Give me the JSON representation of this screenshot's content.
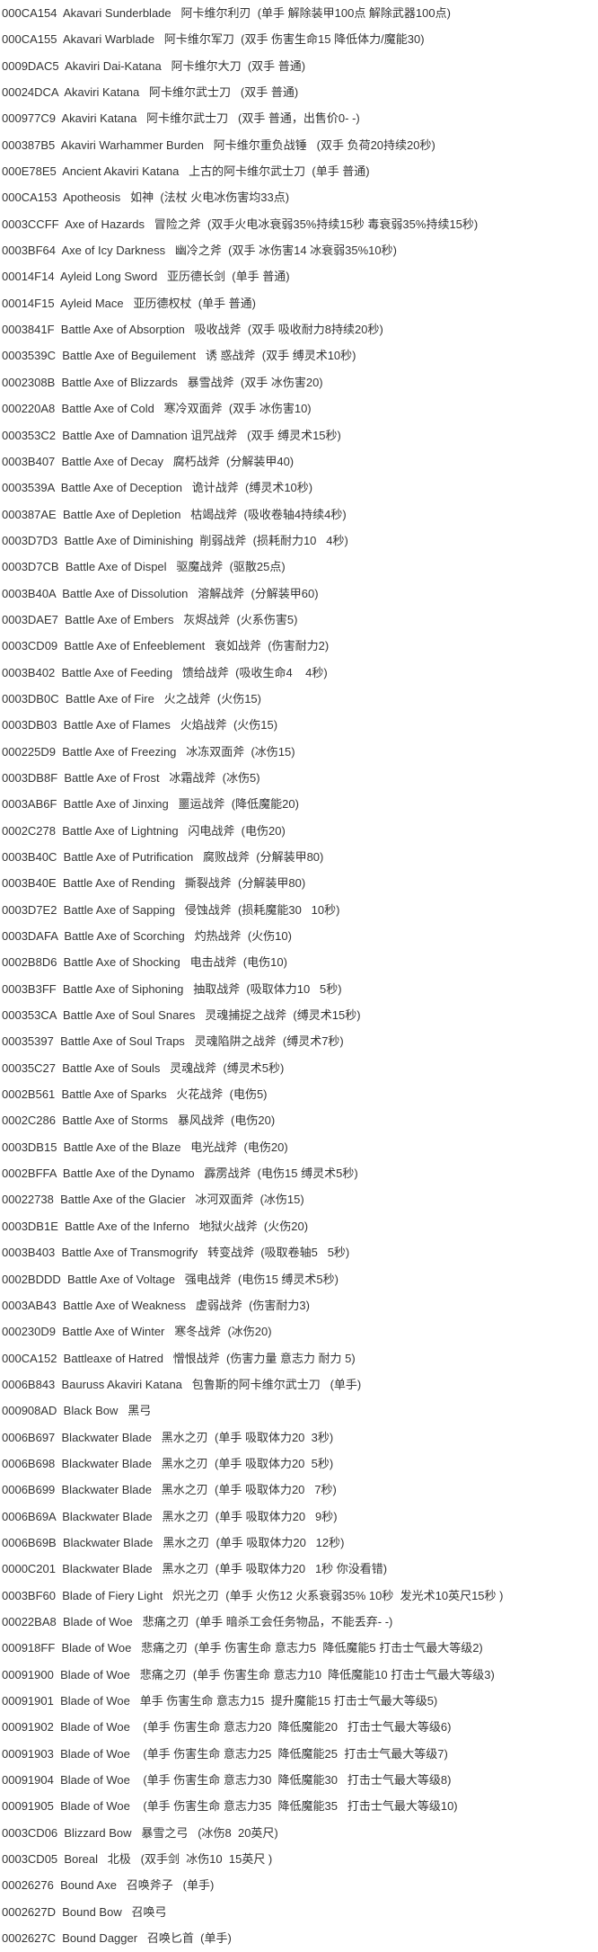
{
  "items": [
    "000CA154  Akavari Sunderblade   阿卡维尔利刃  (单手 解除装甲100点 解除武器100点)",
    "000CA155  Akavari Warblade   阿卡维尔军刀  (双手 伤害生命15 降低体力/魔能30)",
    "0009DAC5  Akaviri Dai-Katana   阿卡维尔大刀  (双手 普通)",
    "00024DCA  Akaviri Katana   阿卡维尔武士刀   (双手 普通)",
    "000977C9  Akaviri Katana   阿卡维尔武士刀   (双手 普通，出售价0- -)",
    "000387B5  Akaviri Warhammer Burden   阿卡维尔重负战锤   (双手 负荷20持续20秒)",
    "000E78E5  Ancient Akaviri Katana   上古的阿卡维尔武士刀  (单手 普通)",
    "000CA153  Apotheosis   如神  (法杖 火电冰伤害均33点)",
    "0003CCFF  Axe of Hazards   冒险之斧  (双手火电冰衰弱35%持续15秒 毒衰弱35%持续15秒)",
    "0003BF64  Axe of Icy Darkness   幽冷之斧  (双手 冰伤害14 冰衰弱35%10秒)",
    "00014F14  Ayleid Long Sword   亚历德长剑  (单手 普通)",
    "00014F15  Ayleid Mace   亚历德权杖  (单手 普通)",
    "0003841F  Battle Axe of Absorption   吸收战斧  (双手 吸收耐力8持续20秒)",
    "0003539C  Battle Axe of Beguilement   诱 惑战斧  (双手 缚灵术10秒)",
    "0002308B  Battle Axe of Blizzards   暴雪战斧  (双手 冰伤害20)",
    "000220A8  Battle Axe of Cold   寒冷双面斧  (双手 冰伤害10)",
    "000353C2  Battle Axe of Damnation 诅咒战斧   (双手 缚灵术15秒)",
    "0003B407  Battle Axe of Decay   腐朽战斧  (分解装甲40)",
    "0003539A  Battle Axe of Deception   诡计战斧  (缚灵术10秒)",
    "000387AE  Battle Axe of Depletion   枯竭战斧  (吸收卷轴4持续4秒)",
    "0003D7D3  Battle Axe of Diminishing  削弱战斧  (损耗耐力10   4秒)",
    "0003D7CB  Battle Axe of Dispel   驱魔战斧  (驱散25点)",
    "0003B40A  Battle Axe of Dissolution   溶解战斧  (分解装甲60)",
    "0003DAE7  Battle Axe of Embers   灰烬战斧  (火系伤害5)",
    "0003CD09  Battle Axe of Enfeeblement   衰如战斧  (伤害耐力2)",
    "0003B402  Battle Axe of Feeding   馈给战斧  (吸收生命4    4秒)",
    "0003DB0C  Battle Axe of Fire   火之战斧  (火伤15)",
    "0003DB03  Battle Axe of Flames   火焰战斧  (火伤15)",
    "000225D9  Battle Axe of Freezing   冰冻双面斧  (冰伤15)",
    "0003DB8F  Battle Axe of Frost   冰霜战斧  (冰伤5)",
    "0003AB6F  Battle Axe of Jinxing   噩运战斧  (降低魔能20)",
    "0002C278  Battle Axe of Lightning   闪电战斧  (电伤20)",
    "0003B40C  Battle Axe of Putrification   腐败战斧  (分解装甲80)",
    "0003B40E  Battle Axe of Rending   撕裂战斧  (分解装甲80)",
    "0003D7E2  Battle Axe of Sapping   侵蚀战斧  (损耗魔能30   10秒)",
    "0003DAFA  Battle Axe of Scorching   灼热战斧  (火伤10)",
    "0002B8D6  Battle Axe of Shocking   电击战斧  (电伤10)",
    "0003B3FF  Battle Axe of Siphoning   抽取战斧  (吸取体力10   5秒)",
    "000353CA  Battle Axe of Soul Snares   灵魂捕捉之战斧  (缚灵术15秒)",
    "00035397  Battle Axe of Soul Traps   灵魂陷阱之战斧  (缚灵术7秒)",
    "00035C27  Battle Axe of Souls   灵魂战斧  (缚灵术5秒)",
    "0002B561  Battle Axe of Sparks   火花战斧  (电伤5)",
    "0002C286  Battle Axe of Storms   暴风战斧  (电伤20)",
    "0003DB15  Battle Axe of the Blaze   电光战斧  (电伤20)",
    "0002BFFA  Battle Axe of the Dynamo   霹雳战斧  (电伤15 缚灵术5秒)",
    "00022738  Battle Axe of the Glacier   冰河双面斧  (冰伤15)",
    "0003DB1E  Battle Axe of the Inferno   地狱火战斧  (火伤20)",
    "0003B403  Battle Axe of Transmogrify   转变战斧  (吸取卷轴5   5秒)",
    "0002BDDD  Battle Axe of Voltage   强电战斧  (电伤15 缚灵术5秒)",
    "0003AB43  Battle Axe of Weakness   虚弱战斧  (伤害耐力3)",
    "000230D9  Battle Axe of Winter   寒冬战斧  (冰伤20)",
    "000CA152  Battleaxe of Hatred   憎恨战斧  (伤害力量 意志力 耐力 5)",
    "0006B843  Bauruss Akaviri Katana   包鲁斯的阿卡维尔武士刀   (单手)",
    "000908AD  Black Bow   黑弓",
    "0006B697  Blackwater Blade   黑水之刃  (单手 吸取体力20  3秒)",
    "0006B698  Blackwater Blade   黑水之刃  (单手 吸取体力20  5秒)",
    "0006B699  Blackwater Blade   黑水之刃  (单手 吸取体力20   7秒)",
    "0006B69A  Blackwater Blade   黑水之刃  (单手 吸取体力20   9秒)",
    "0006B69B  Blackwater Blade   黑水之刃  (单手 吸取体力20   12秒)",
    "0000C201  Blackwater Blade   黑水之刃  (单手 吸取体力20   1秒 你没看错)",
    "0003BF60  Blade of Fiery Light   炽光之刃  (单手 火伤12 火系衰弱35% 10秒  发光术10英尺15秒 )",
    "00022BA8  Blade of Woe   悲痛之刃  (单手 暗杀工会任务物品，不能丢弃- -)",
    "000918FF  Blade of Woe   悲痛之刃  (单手 伤害生命 意志力5  降低魔能5 打击士气最大等级2)",
    "00091900  Blade of Woe   悲痛之刃  (单手 伤害生命 意志力10  降低魔能10 打击士气最大等级3)",
    "00091901  Blade of Woe   单手 伤害生命 意志力15  提升魔能15 打击士气最大等级5)",
    "00091902  Blade of Woe    (单手 伤害生命 意志力20  降低魔能20   打击士气最大等级6)",
    "00091903  Blade of Woe    (单手 伤害生命 意志力25  降低魔能25  打击士气最大等级7)",
    "00091904  Blade of Woe    (单手 伤害生命 意志力30  降低魔能30   打击士气最大等级8)",
    "00091905  Blade of Woe    (单手 伤害生命 意志力35  降低魔能35   打击士气最大等级10)",
    "0003CD06  Blizzard Bow   暴雪之弓   (冰伤8  20英尺)",
    "0003CD05  Boreal   北极   (双手剑  冰伤10  15英尺 )",
    "00026276  Bound Axe   召唤斧子   (单手)",
    "0002627D  Bound Bow   召唤弓",
    "0002627C  Bound Dagger   召唤匕首  (单手)"
  ]
}
